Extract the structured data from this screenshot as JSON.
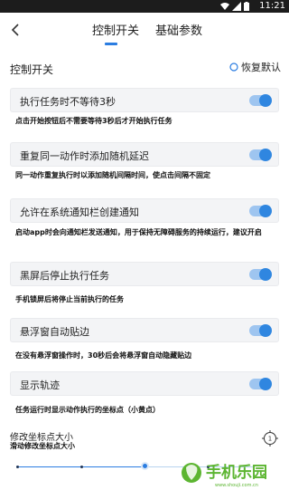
{
  "status_bar": {
    "time": "11:21"
  },
  "nav": {
    "tabs": [
      {
        "label": "控制开关",
        "active": true
      },
      {
        "label": "基础参数",
        "active": false
      }
    ]
  },
  "section": {
    "title": "控制开关",
    "restore_label": "恢复默认"
  },
  "settings": [
    {
      "label": "执行任务时不等待3秒",
      "enabled": true,
      "desc": "点击开始按钮后不需要等待3秒后才开始执行任务"
    },
    {
      "label": "重复同一动作时添加随机延迟",
      "enabled": true,
      "desc": "同一动作重复执行时以添加随机间隔时间，使点击间隔不固定"
    },
    {
      "label": "允许在系统通知栏创建通知",
      "enabled": true,
      "desc": "启动app时会向通知栏发送通知，用于保持无障碍服务的持续运行，建议开启"
    },
    {
      "label": "黑屏后停止执行任务",
      "enabled": true,
      "desc": "手机锁屏后将停止当前执行的任务"
    },
    {
      "label": "悬浮窗自动贴边",
      "enabled": true,
      "desc": "在没有悬浮窗操作时，30秒后会将悬浮窗自动隐藏贴边"
    },
    {
      "label": "显示轨迹",
      "enabled": true,
      "desc": "任务运行时显示动作执行的坐标点（小黄点）"
    }
  ],
  "coord_size": {
    "title": "修改坐标点大小",
    "desc": "滑动修改坐标点大小",
    "level_fraction": 0.54
  },
  "watermark": {
    "brand": "手机乐园",
    "url": "www.shouji.com.cn"
  },
  "colors": {
    "accent": "#2b7de1",
    "toggle_track": "#9ec5f0",
    "card_bg": "#f3f4f6",
    "watermark_green": "#5cb531"
  }
}
